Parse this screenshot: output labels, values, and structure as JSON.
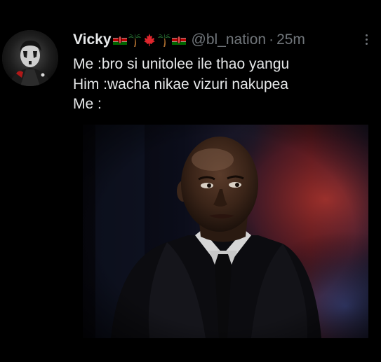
{
  "tweet": {
    "author": {
      "display_name": "Vicky",
      "handle": "@bl_nation",
      "flag_emojis": [
        "kenya-flag",
        "palm-tree",
        "maple-leaf",
        "palm-tree",
        "kenya-flag"
      ]
    },
    "separator": "·",
    "time": "25m",
    "lines": [
      "Me :bro si unitolee ile thao yangu",
      "Him :wacha nikae vizuri nakupea",
      "Me :"
    ]
  },
  "colors": {
    "background": "#000000",
    "primary_text": "#e7e9ea",
    "secondary_text": "#71767b"
  }
}
